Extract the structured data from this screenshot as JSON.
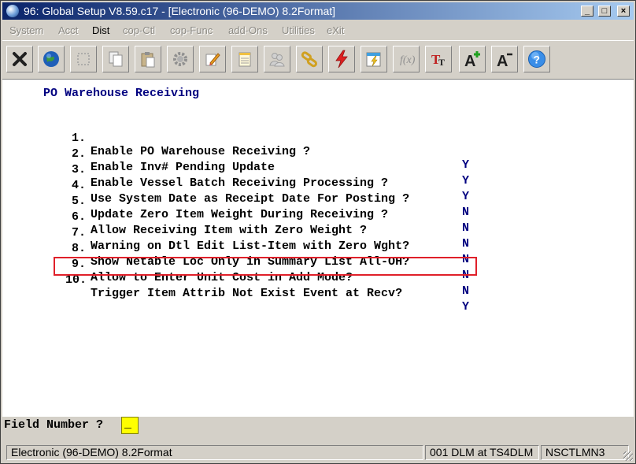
{
  "window": {
    "title": "96: Global Setup V8.59.c17 - [Electronic (96-DEMO) 8.2Format]",
    "controls": {
      "minimize": "_",
      "maximize": "□",
      "close": "×"
    }
  },
  "menu": [
    {
      "label": "System"
    },
    {
      "label": "Acct"
    },
    {
      "label": "Dist"
    },
    {
      "label": "cop-Ctl"
    },
    {
      "label": "cop-Func"
    },
    {
      "label": "add-Ons"
    },
    {
      "label": "Utilities"
    },
    {
      "label": "eXit"
    }
  ],
  "toolbar": {
    "icons": [
      "exit-icon",
      "globe-icon",
      "select-icon",
      "copy-icon",
      "paste-icon",
      "gear-icon",
      "edit-icon",
      "notepad-icon",
      "users-icon",
      "link-icon",
      "lightning-icon",
      "calendar-icon",
      "function-icon",
      "font-icon",
      "increase-font-icon",
      "decrease-font-icon",
      "help-icon"
    ]
  },
  "screen": {
    "title": "PO Warehouse Receiving",
    "options": [
      {
        "num": "1.",
        "label": "Enable PO Warehouse Receiving ?",
        "value": "Y"
      },
      {
        "num": "2.",
        "label": "Enable Inv# Pending Update",
        "value": "Y"
      },
      {
        "num": "3.",
        "label": "Enable Vessel Batch Receiving Processing ?",
        "value": "Y"
      },
      {
        "num": "4.",
        "label": "Use System Date as Receipt Date For Posting ?",
        "value": "N"
      },
      {
        "num": "5.",
        "label": "Update Zero Item Weight During Receiving ?",
        "value": "N"
      },
      {
        "num": "6.",
        "label": "Allow Receiving Item with Zero Weight ?",
        "value": "N"
      },
      {
        "num": "7.",
        "label": "Warning on Dtl Edit List-Item with Zero Wght?",
        "value": "N"
      },
      {
        "num": "8.",
        "label": "Show Netable Loc Only in Summary List All-OH?",
        "value": "N"
      },
      {
        "num": "9.",
        "label": "Allow to Enter Unit Cost in Add Mode?",
        "value": "N"
      },
      {
        "num": "10.",
        "label": "Trigger Item Attrib Not Exist Event at Recv?",
        "value": "Y"
      }
    ]
  },
  "prompt": {
    "label": "Field Number ?",
    "value": "_"
  },
  "status": {
    "company": "Electronic (96-DEMO) 8.2Format",
    "user": "001 DLM at TS4DLM",
    "code": "NSCTLMN3"
  },
  "colors": {
    "highlight": "#e0202a",
    "field_bg": "#ffff00",
    "title_text": "#000080"
  }
}
